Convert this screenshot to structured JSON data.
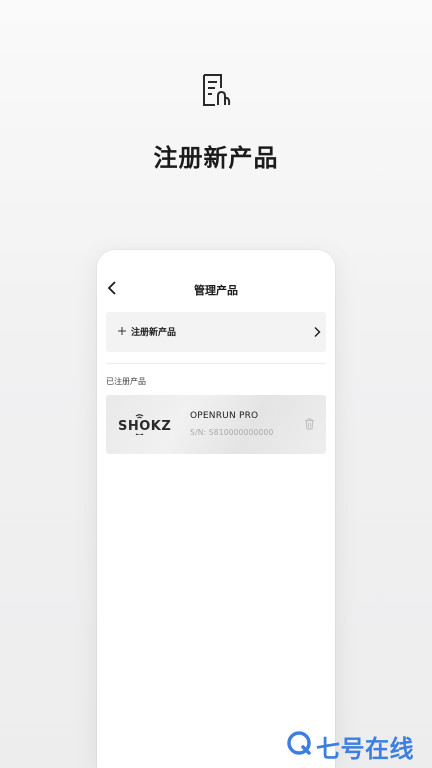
{
  "hero": {
    "title": "注册新产品",
    "icon": "register-document-icon"
  },
  "app": {
    "nav_title": "管理产品",
    "back_icon": "chevron-left-icon",
    "register_row": {
      "plus": "+",
      "label": "注册新产品",
      "chevron": "chevron-right-icon"
    },
    "section_label": "已注册产品",
    "product": {
      "brand": "SHOKZ",
      "name": "OPENRUN PRO",
      "serial": "S/N: S810000000000",
      "delete_icon": "trash-icon"
    }
  },
  "watermark": {
    "text": "七号在线",
    "icon": "q-circle-icon"
  },
  "colors": {
    "accent": "#3d7fe0",
    "text_primary": "#1b1b1b",
    "text_muted": "#a8a8a8",
    "row_bg": "#f3f3f3"
  }
}
